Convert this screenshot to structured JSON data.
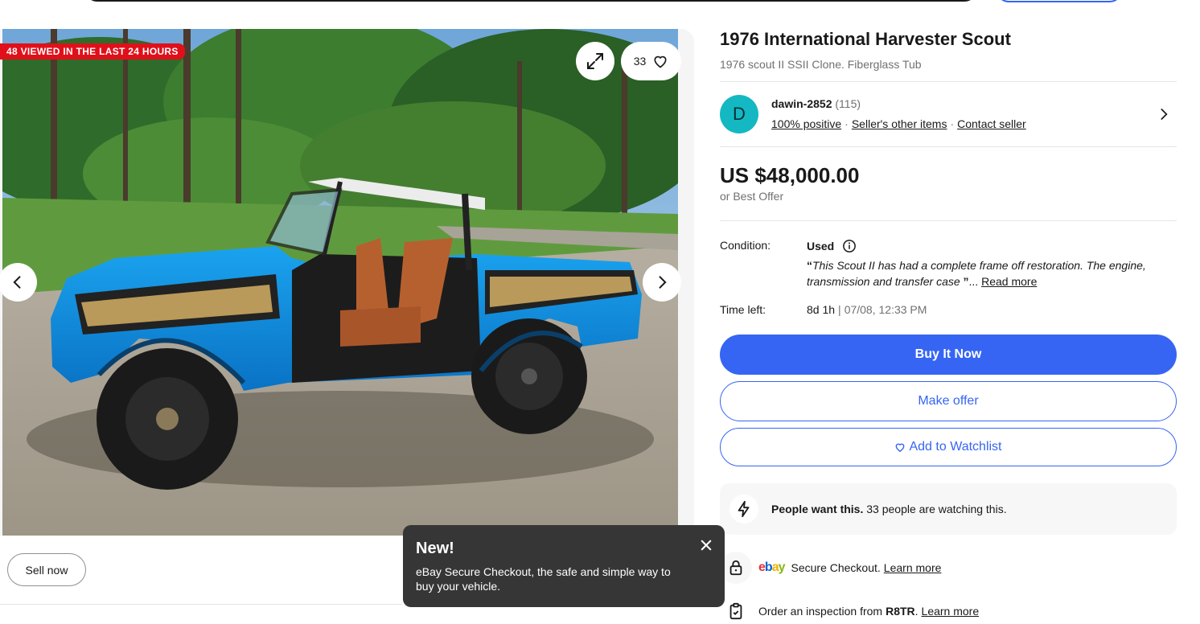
{
  "gallery": {
    "viewed_badge": "48 VIEWED IN THE LAST 24 HOURS",
    "watch_count": "33",
    "photo_alt": "1976 International Harvester Scout"
  },
  "sell_now_label": "Sell now",
  "tooltip": {
    "title": "New!",
    "body": "eBay Secure Checkout, the safe and simple way to buy your vehicle."
  },
  "listing": {
    "title": "1976 International Harvester Scout",
    "subtitle": "1976 scout II SSII Clone. Fiberglass Tub"
  },
  "seller": {
    "initial": "D",
    "name": "dawin-2852",
    "feedback_count": "(115)",
    "positive": "100% positive",
    "other_items": "Seller's other items",
    "contact": "Contact seller"
  },
  "price": {
    "amount": "US $48,000.00",
    "best_offer": "or Best Offer"
  },
  "condition": {
    "label": "Condition:",
    "value": "Used",
    "open_quote": "“",
    "description": "This Scout II has had a complete frame off restoration. The engine, transmission and transfer case",
    "close_quote": "”",
    "ellipsis": "... ",
    "read_more": "Read more"
  },
  "time_left": {
    "label": "Time left:",
    "remaining": "8d 1h",
    "separator": "|",
    "end_date": "07/08, 12:33 PM"
  },
  "buttons": {
    "buy_now": "Buy It Now",
    "make_offer": "Make offer",
    "add_watchlist": "Add to Watchlist"
  },
  "signal": {
    "bold": "People want this.",
    "text": " 33 people are watching this."
  },
  "secure": {
    "logo": [
      "e",
      "b",
      "a",
      "y"
    ],
    "text": "Secure Checkout.",
    "link": "Learn more"
  },
  "inspection": {
    "text": "Order an inspection from",
    "provider": "R8TR",
    "period": ".",
    "link": "Learn more"
  },
  "colors": {
    "primary_blue": "#3665f3",
    "badge_red": "#e0101b",
    "avatar_teal": "#14b8c2",
    "tooltip_bg": "#363636"
  }
}
